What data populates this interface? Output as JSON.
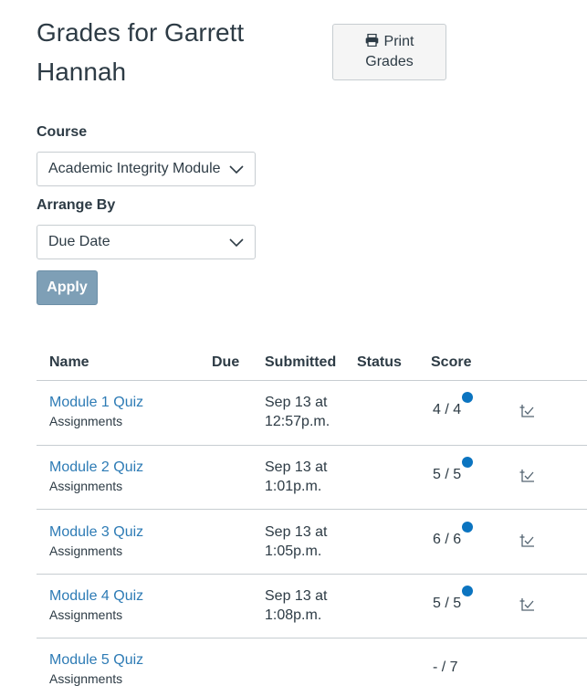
{
  "header": {
    "title": "Grades for Garrett Hannah",
    "print_label": "Print Grades"
  },
  "filters": {
    "course_label": "Course",
    "course_value": "Academic Integrity Module",
    "arrange_label": "Arrange By",
    "arrange_value": "Due Date",
    "apply_label": "Apply"
  },
  "table": {
    "headers": [
      "Name",
      "Due",
      "Submitted",
      "Status",
      "Score"
    ],
    "rows": [
      {
        "name": "Module 1 Quiz",
        "category": "Assignments",
        "submitted_line1": "Sep 13 at",
        "submitted_line2": "12:57p.m.",
        "score": "4 / 4",
        "unread_dot": true
      },
      {
        "name": "Module 2 Quiz",
        "category": "Assignments",
        "submitted_line1": "Sep 13 at",
        "submitted_line2": "1:01p.m.",
        "score": "5 / 5",
        "unread_dot": true
      },
      {
        "name": "Module 3 Quiz",
        "category": "Assignments",
        "submitted_line1": "Sep 13 at",
        "submitted_line2": "1:05p.m.",
        "score": "6 / 6",
        "unread_dot": true
      },
      {
        "name": "Module 4 Quiz",
        "category": "Assignments",
        "submitted_line1": "Sep 13 at",
        "submitted_line2": "1:08p.m.",
        "score": "5 / 5",
        "unread_dot": true
      },
      {
        "name": "Module 5 Quiz",
        "category": "Assignments",
        "submitted_line1": "",
        "submitted_line2": "",
        "score": "- / 7",
        "unread_dot": false
      }
    ]
  },
  "colors": {
    "link": "#2d7bb5",
    "unread_dot": "#0b74c0",
    "apply_button": "#7e9fb6"
  }
}
